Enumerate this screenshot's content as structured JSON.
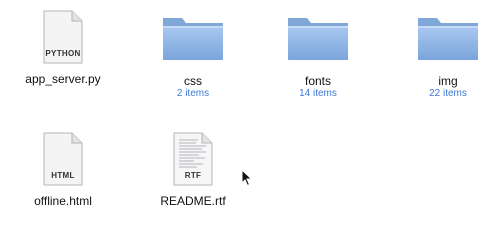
{
  "files": [
    {
      "name": "app_server.py",
      "type_label": "PYTHON",
      "kind": "document"
    },
    {
      "name": "css",
      "sub": "2 items",
      "kind": "folder"
    },
    {
      "name": "fonts",
      "sub": "14 items",
      "kind": "folder"
    },
    {
      "name": "img",
      "sub": "22 items",
      "kind": "folder"
    },
    {
      "name": "offline.html",
      "type_label": "HTML",
      "kind": "document"
    },
    {
      "name": "README.rtf",
      "type_label": "RTF",
      "kind": "document-text"
    }
  ],
  "colors": {
    "folder_blue": "#8db4e6",
    "item_count": "#3f7ad6"
  },
  "icons": {
    "folder": "folder-icon",
    "document": "document-icon",
    "cursor": "mouse-cursor-icon"
  }
}
